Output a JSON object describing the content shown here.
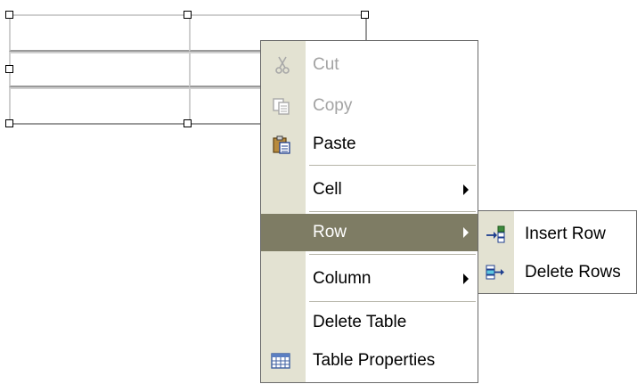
{
  "context_menu": {
    "items": [
      {
        "label": "Cut",
        "icon": "scissors-icon",
        "enabled": false,
        "submenu": false
      },
      {
        "label": "Copy",
        "icon": "copy-icon",
        "enabled": false,
        "submenu": false
      },
      {
        "label": "Paste",
        "icon": "paste-icon",
        "enabled": true,
        "submenu": false
      },
      {
        "label": "Cell",
        "enabled": true,
        "submenu": true
      },
      {
        "label": "Row",
        "enabled": true,
        "submenu": true,
        "highlighted": true
      },
      {
        "label": "Column",
        "enabled": true,
        "submenu": true
      },
      {
        "label": "Delete Table",
        "enabled": true,
        "submenu": false
      },
      {
        "label": "Table Properties",
        "icon": "table-grid-icon",
        "enabled": true,
        "submenu": false
      }
    ]
  },
  "row_submenu": {
    "items": [
      {
        "label": "Insert Row",
        "icon": "insert-row-icon"
      },
      {
        "label": "Delete Rows",
        "icon": "delete-rows-icon"
      }
    ]
  },
  "colors": {
    "icon_rail": "#e3e2d2",
    "highlight": "#7e7c64",
    "disabled_text": "#a3a3a3"
  }
}
